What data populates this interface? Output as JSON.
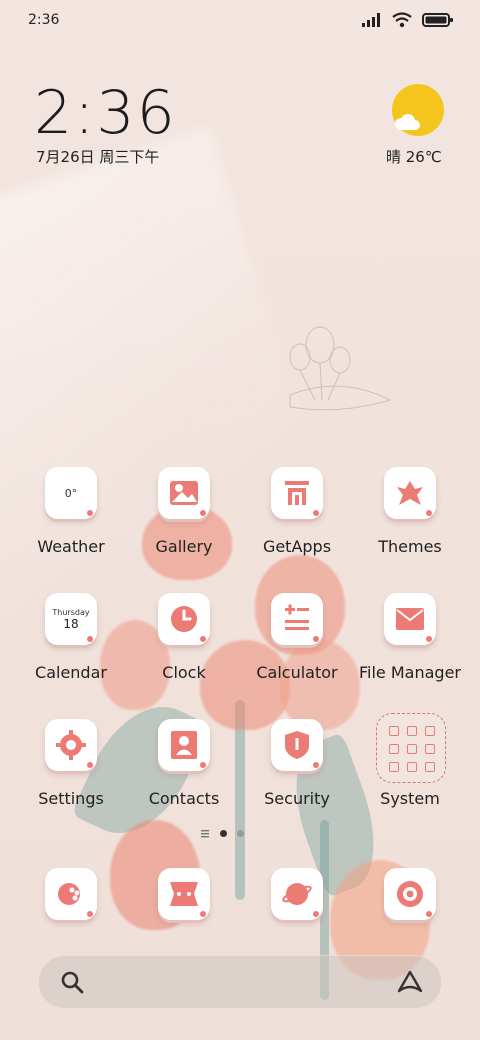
{
  "status_bar": {
    "time": "2:36",
    "icons": [
      "signal-icon",
      "wifi-icon",
      "battery-icon"
    ]
  },
  "clock_widget": {
    "time": "2:36",
    "date": "7月26日 周三下午"
  },
  "weather_widget": {
    "condition_temp": "晴 26℃",
    "icon": "sun-cloud-icon",
    "accent": "#f4c51c"
  },
  "apps": [
    {
      "name": "Weather",
      "icon": "weather-icon",
      "icon_text": "0°"
    },
    {
      "name": "Gallery",
      "icon": "gallery-icon"
    },
    {
      "name": "GetApps",
      "icon": "getapps-icon"
    },
    {
      "name": "Themes",
      "icon": "themes-icon"
    },
    {
      "name": "Calendar",
      "icon": "calendar-icon",
      "icon_day": "Thursday",
      "icon_date": "18"
    },
    {
      "name": "Clock",
      "icon": "clock-icon"
    },
    {
      "name": "Calculator",
      "icon": "calculator-icon"
    },
    {
      "name": "File Manager",
      "icon": "mail-icon"
    },
    {
      "name": "Settings",
      "icon": "gear-icon"
    },
    {
      "name": "Contacts",
      "icon": "contacts-icon"
    },
    {
      "name": "Security",
      "icon": "shield-icon"
    },
    {
      "name": "System",
      "icon": "folder-icon"
    }
  ],
  "page_indicator": {
    "total": 2,
    "active": 1
  },
  "dock": [
    {
      "icon": "phone-icon"
    },
    {
      "icon": "messages-icon"
    },
    {
      "icon": "browser-icon"
    },
    {
      "icon": "camera-icon"
    }
  ],
  "search_bar": {
    "left_icon": "search-icon",
    "right_icon": "assistant-icon"
  },
  "colors": {
    "accent": "#ec7a75",
    "background": "#f1e3dd"
  }
}
